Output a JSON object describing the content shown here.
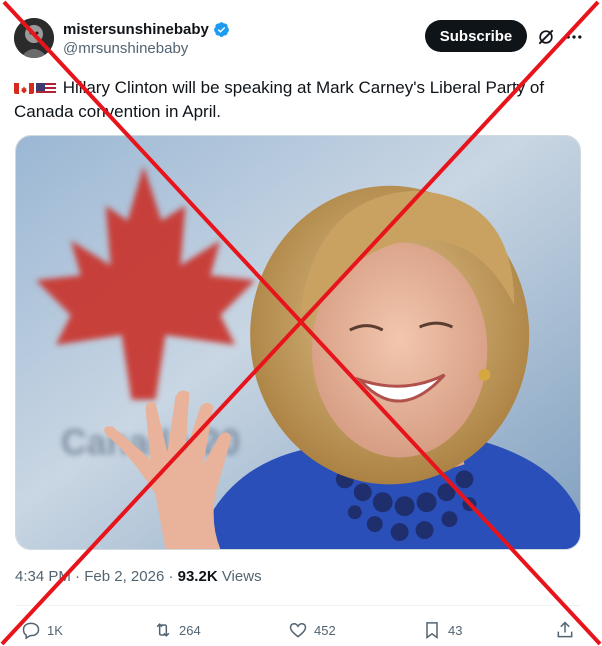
{
  "author": {
    "display_name": "mistersunshinebaby",
    "handle": "@mrsunshinebaby",
    "verified": true
  },
  "subscribe_label": "Subscribe",
  "tweet": {
    "flags": [
      "flag-canada",
      "flag-usa"
    ],
    "text": "Hillary Clinton will be speaking at Mark Carney's Liberal Party of Canada convention in April."
  },
  "media": {
    "background_text": "Canada 20",
    "overlay": "red-x-cross"
  },
  "meta": {
    "time": "4:34 PM",
    "separator": " · ",
    "date": "Feb 2, 2026",
    "views_count": "93.2K",
    "views_label": "Views"
  },
  "actions": {
    "replies": "1K",
    "reposts": "264",
    "likes": "452",
    "bookmarks": "43"
  },
  "colors": {
    "accent": "#1d9bf0",
    "x_mark": "#e8141c",
    "canada_red": "#d52b1e",
    "blazer_blue": "#2a4fb8"
  }
}
